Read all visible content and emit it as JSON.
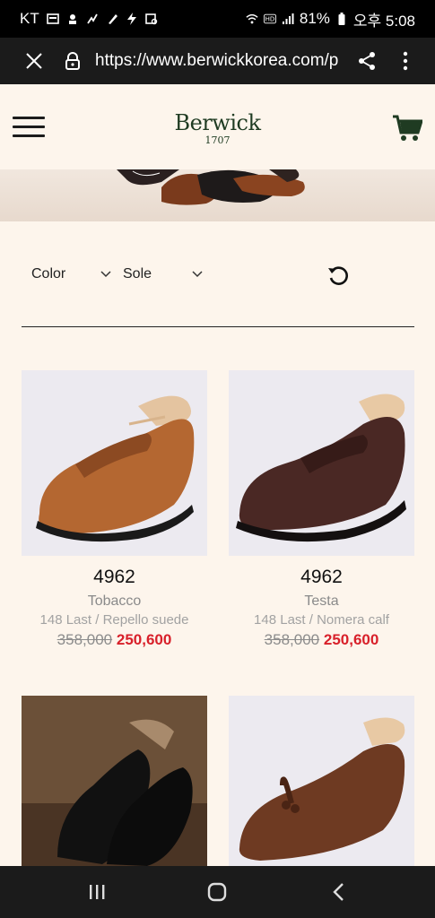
{
  "status": {
    "carrier": "KT",
    "battery": "81%",
    "time": "오후 5:08"
  },
  "browser": {
    "url": "https://www.berwickkorea.com/p"
  },
  "site": {
    "brand": "Berwick",
    "brand_year": "1707"
  },
  "filters": {
    "color_label": "Color",
    "sole_label": "Sole"
  },
  "products": [
    {
      "name": "4962",
      "color": "Tobacco",
      "desc": "148 Last / Repello suede",
      "price_original": "358,000",
      "price_sale": "250,600",
      "image_tint": "#b76a33"
    },
    {
      "name": "4962",
      "color": "Testa",
      "desc": "148 Last / Nomera calf",
      "price_original": "358,000",
      "price_sale": "250,600",
      "image_tint": "#4a2a22"
    },
    {
      "name": "",
      "color": "",
      "desc": "",
      "price_original": "",
      "price_sale": "",
      "image_tint": "#121212"
    },
    {
      "name": "",
      "color": "",
      "desc": "",
      "price_original": "",
      "price_sale": "",
      "image_tint": "#6e3a22"
    }
  ],
  "icons": {
    "close": "close-icon",
    "lock": "lock-icon",
    "share": "share-icon",
    "more": "more-vert-icon",
    "menu": "hamburger-menu-icon",
    "cart": "shopping-cart-icon",
    "reset": "refresh-icon",
    "chevron": "chevron-down-icon"
  },
  "colors": {
    "brand_green": "#1f3b22",
    "sale_red": "#d8202a",
    "page_bg": "#fdf5ec"
  }
}
